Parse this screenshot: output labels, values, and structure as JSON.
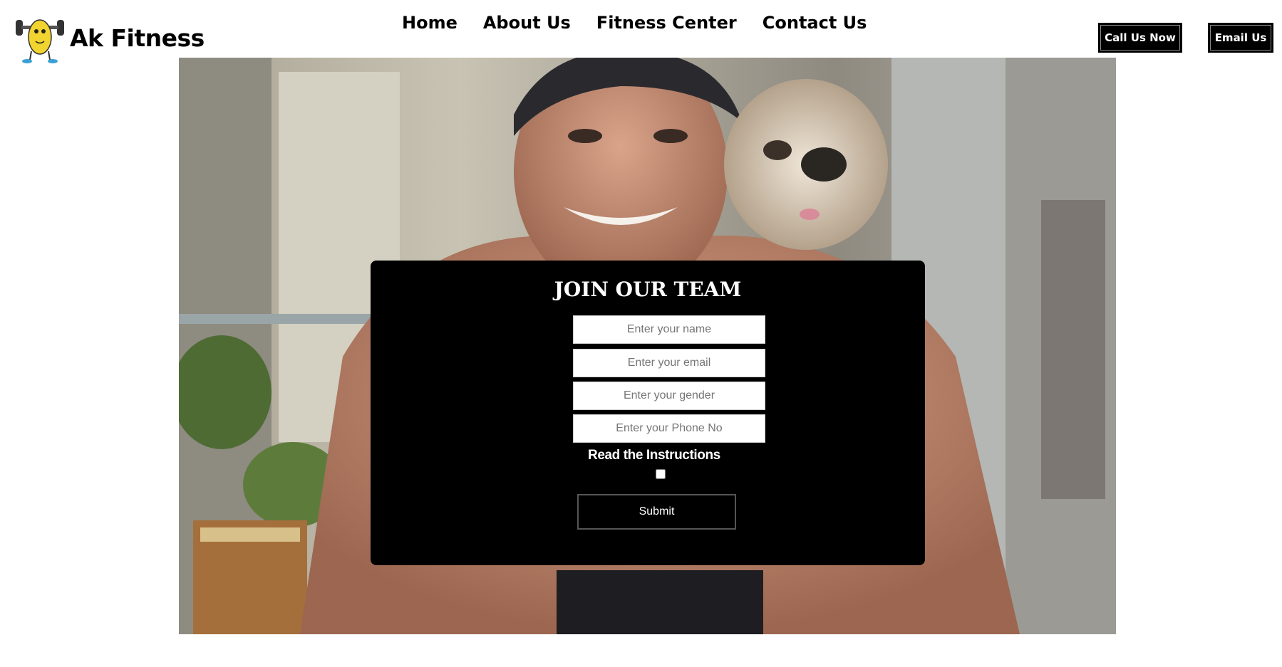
{
  "brand": {
    "name": "Ak Fitness",
    "logo_icon": "dumbbell-mascot-icon"
  },
  "nav": {
    "items": [
      {
        "label": "Home"
      },
      {
        "label": "About Us"
      },
      {
        "label": "Fitness Center"
      },
      {
        "label": "Contact Us"
      }
    ]
  },
  "header_buttons": {
    "call": "Call Us Now",
    "email": "Email Us"
  },
  "hero": {
    "image": "man-with-dog-photo"
  },
  "form": {
    "title": "JOIN OUR TEAM",
    "name_placeholder": "Enter your name",
    "email_placeholder": "Enter your email",
    "gender_placeholder": "Enter your gender",
    "phone_placeholder": "Enter your Phone No",
    "instructions_label": "Read the Instructions",
    "instructions_checked": false,
    "submit_label": "Submit"
  },
  "colors": {
    "panel": "#000000",
    "button": "#000000",
    "text_on_dark": "#ffffff"
  }
}
